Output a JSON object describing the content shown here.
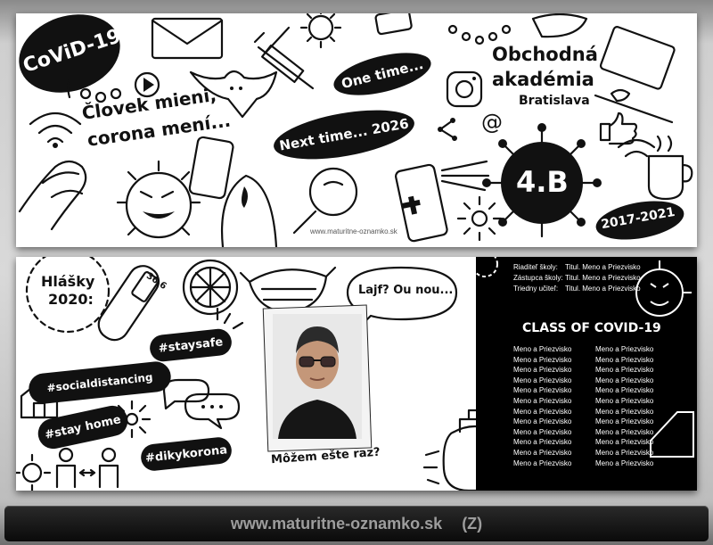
{
  "top": {
    "badge_covid": "CoViD-19",
    "slogan_line1": "Človek mieni,",
    "slogan_line2": "corona mení...",
    "one_time": "One time...",
    "next_time": "Next time... 2026",
    "school_line1": "Obchodná",
    "school_line2": "akadémia",
    "school_city": "Bratislava",
    "class_badge": "4.B",
    "years": "2017-2021",
    "watermark": "www.maturitne-oznamko.sk"
  },
  "bottom": {
    "hlasky_line1": "Hlášky",
    "hlasky_line2": "2020:",
    "thermometer": "36,6",
    "tags": [
      "#staysafe",
      "#socialdistancing",
      "#stay home",
      "#dikykorona"
    ],
    "speech": "Lajf? Ou nou...",
    "caption": "Môžem ešte raz?",
    "staff": [
      {
        "role": "Riaditeľ školy:",
        "name": "Titul. Meno a Priezvisko"
      },
      {
        "role": "Zástupca školy:",
        "name": "Titul. Meno a Priezvisko"
      },
      {
        "role": "Triedny učiteľ:",
        "name": "Titul. Meno a Priezvisko"
      }
    ],
    "class_title": "CLASS OF COVID-19",
    "students_left": [
      "Meno a Priezvisko",
      "Meno a Priezvisko",
      "Meno a Priezvisko",
      "Meno a Priezvisko",
      "Meno a Priezvisko",
      "Meno a Priezvisko",
      "Meno a Priezvisko",
      "Meno a Priezvisko",
      "Meno a Priezvisko",
      "Meno a Priezvisko",
      "Meno a Priezvisko",
      "Meno a Priezvisko"
    ],
    "students_right": [
      "Meno a Priezvisko",
      "Meno a Priezvisko",
      "Meno a Priezvisko",
      "Meno a Priezvisko",
      "Meno a Priezvisko",
      "Meno a Priezvisko",
      "Meno a Priezvisko",
      "Meno a Priezvisko",
      "Meno a Priezvisko",
      "Meno a Priezvisko",
      "Meno a Priezvisko",
      "Meno a Priezvisko"
    ]
  },
  "footer": {
    "url": "www.maturitne-oznamko.sk",
    "code": "(Z)"
  },
  "icons": [
    "virus-icon",
    "envelope-icon",
    "syringe-icon",
    "bat-icon",
    "play-icon",
    "pills-icon",
    "wifi-icon",
    "phone-icon",
    "hands-icon",
    "ghost-icon",
    "magnifier-icon",
    "spray-icon",
    "instagram-icon",
    "laptop-icon",
    "bird-icon",
    "like-icon",
    "share-icon",
    "at-icon",
    "coffee-icon",
    "house-icon",
    "chat-icon",
    "people-icon",
    "lemon-icon",
    "mask-icon",
    "soap-icon",
    "thermometer-icon"
  ]
}
